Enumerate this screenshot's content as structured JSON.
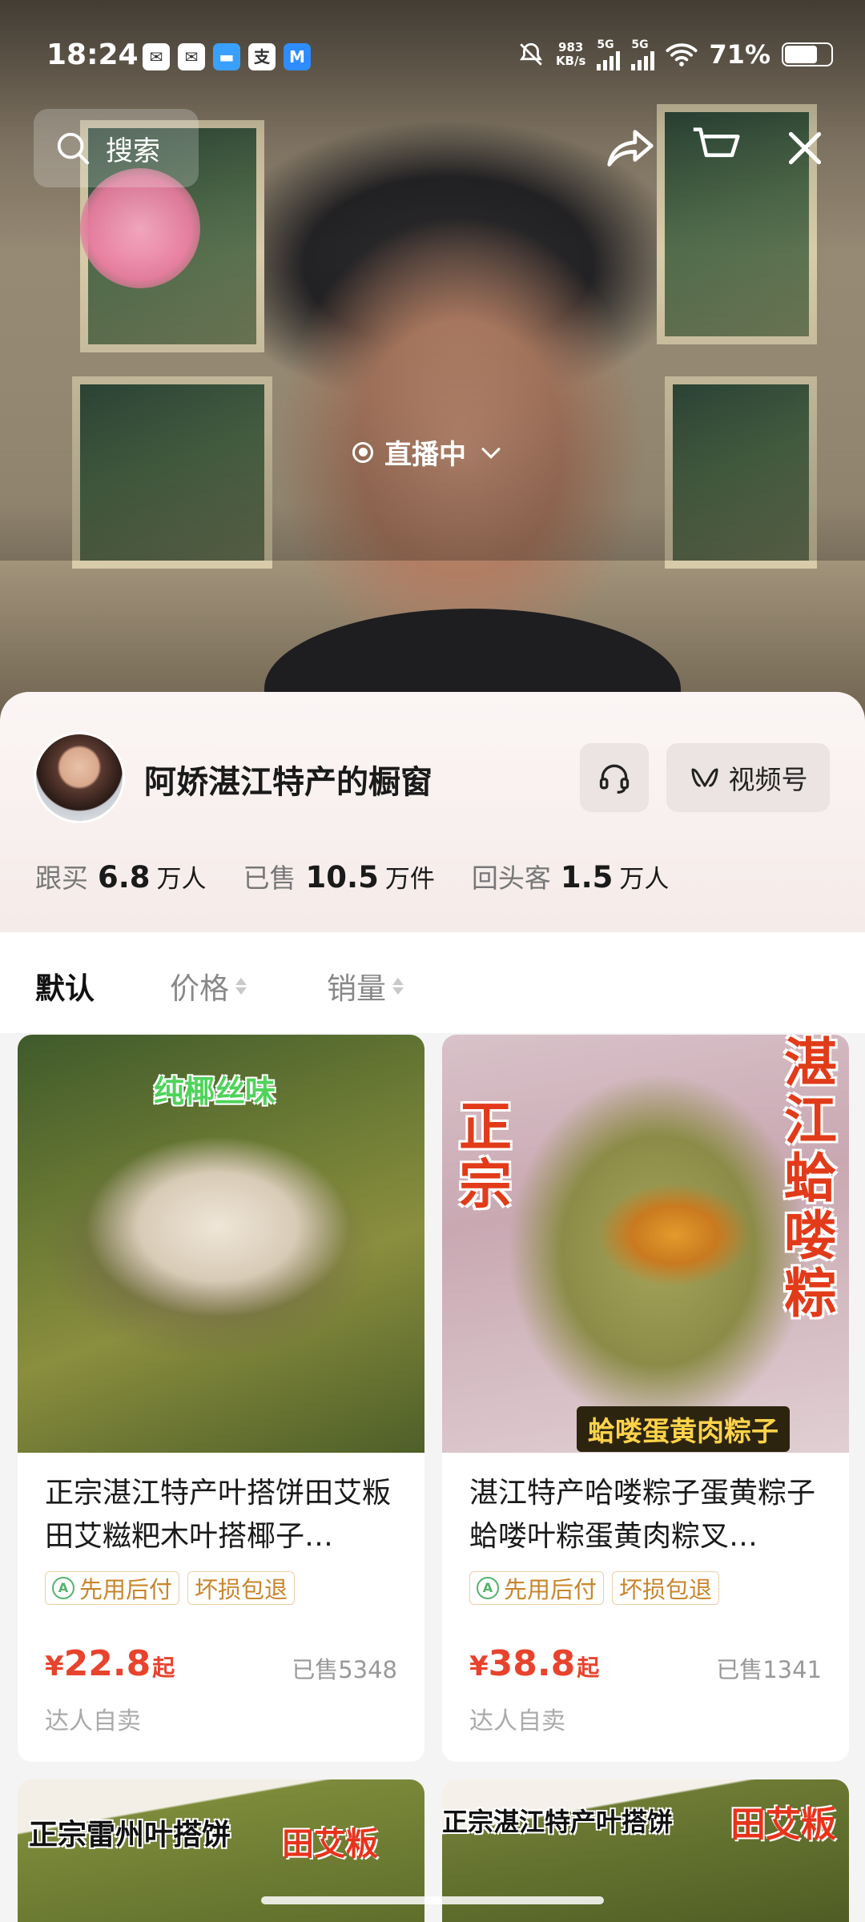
{
  "status_bar": {
    "time": "18:24",
    "net_speed_value": "983",
    "net_speed_unit": "KB/s",
    "sim1": "5G",
    "sim2": "5G",
    "battery_pct": "71%",
    "battery_level": 0.71,
    "notification_icons": [
      "wechat-icon",
      "mail-icon",
      "card-icon",
      "alipay-icon",
      "app-icon"
    ]
  },
  "header": {
    "search_label": "搜索",
    "live_label": "直播中"
  },
  "shop": {
    "name": "阿娇湛江特产的橱窗",
    "channel_button": "视频号",
    "stats": [
      {
        "label": "跟买",
        "value": "6.8",
        "unit": "万人"
      },
      {
        "label": "已售",
        "value": "10.5",
        "unit": "万件"
      },
      {
        "label": "回头客",
        "value": "1.5",
        "unit": "万人"
      }
    ]
  },
  "sort": {
    "default": "默认",
    "price": "价格",
    "sales": "销量"
  },
  "products": [
    {
      "overlay_texts": [
        "纯椰丝味"
      ],
      "title": "正宗湛江特产叶搭饼田艾粄田艾糍粑木叶搭椰子…",
      "tags": [
        "先用后付",
        "坏损包退"
      ],
      "currency": "¥",
      "price": "22.8",
      "price_suffix": "起",
      "sold": "已售5348",
      "seller": "达人自卖"
    },
    {
      "overlay_texts": [
        "正宗",
        "湛江蛤喽粽",
        "蛤喽蛋黄肉粽子"
      ],
      "title": "湛江特产哈喽粽子蛋黄粽子蛤喽叶粽蛋黄肉粽叉…",
      "tags": [
        "先用后付",
        "坏损包退"
      ],
      "currency": "¥",
      "price": "38.8",
      "price_suffix": "起",
      "sold": "已售1341",
      "seller": "达人自卖"
    },
    {
      "overlay_texts": [
        "正宗雷州叶搭饼",
        "田艾粄"
      ]
    },
    {
      "overlay_texts": [
        "正宗湛江特产叶搭饼",
        "田艾粄"
      ]
    }
  ]
}
